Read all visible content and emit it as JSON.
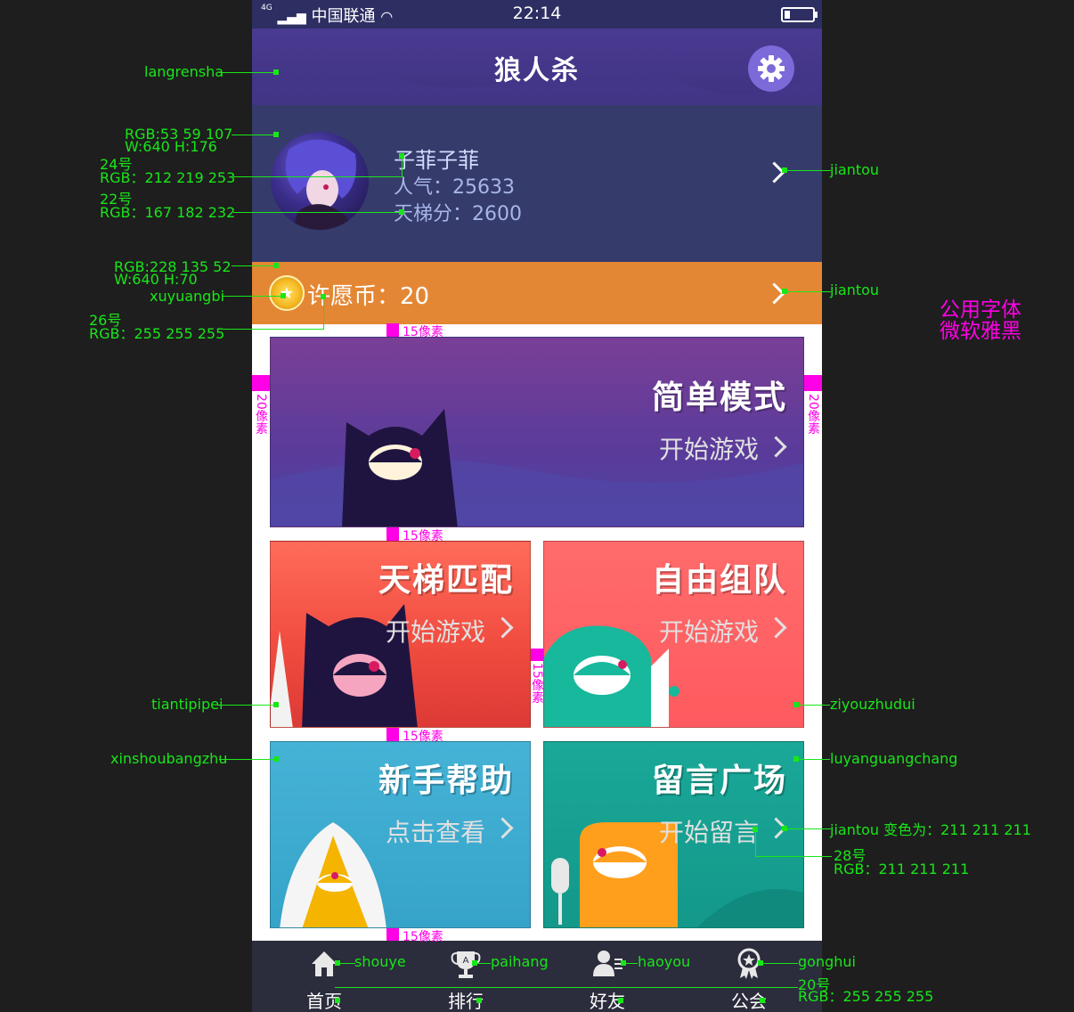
{
  "status_bar": {
    "network": "4G",
    "carrier": "中国联通",
    "time": "22:14"
  },
  "header": {
    "title": "狼人杀"
  },
  "profile": {
    "name": "子菲子菲",
    "popularity": "人气：25633",
    "ladder": "天梯分：2600"
  },
  "wish_coin": {
    "label": "许愿币：20"
  },
  "cards": [
    {
      "title": "简单模式",
      "action": "开始游戏"
    },
    {
      "title": "天梯匹配",
      "action": "开始游戏"
    },
    {
      "title": "自由组队",
      "action": "开始游戏"
    },
    {
      "title": "新手帮助",
      "action": "点击查看"
    },
    {
      "title": "留言广场",
      "action": "开始留言"
    }
  ],
  "tabs": [
    {
      "label": "首页",
      "icon": "home-icon"
    },
    {
      "label": "排行",
      "icon": "trophy-icon"
    },
    {
      "label": "好友",
      "icon": "friends-icon"
    },
    {
      "label": "公会",
      "icon": "guild-icon"
    }
  ],
  "annotations": {
    "langrensha": "langrensha",
    "profile_rgb": "RGB:53  59  107",
    "profile_size": "W:640   H:176",
    "name_size": "24号",
    "name_rgb": "RGB：212  219  253",
    "stat_size": "22号",
    "stat_rgb": "RGB：167  182  232",
    "coin_rgb": "RGB:228  135  52",
    "coin_size": "W:640   H:70",
    "xuyuangbi": "xuyuangbi",
    "coin_font_size": "26号",
    "coin_font_rgb": "RGB：255  255  255",
    "jiantou": "jiantou",
    "tiantipipei": "tiantipipei",
    "ziyouzhudui": "ziyouzhudui",
    "xinshoubangzhu": "xinshoubangzhu",
    "luyanguangchang": "luyanguangchang",
    "jiantou_color": "jiantou  变色为：211  211  211",
    "action_size": "28号",
    "action_rgb": "RGB：211  211  211",
    "shouye": "shouye",
    "paihang": "paihang",
    "haoyou": "haoyou",
    "gonghui": "gonghui",
    "tab_size": "20号",
    "tab_rgb": "RGB：255  255  255",
    "gap15": "15像素",
    "gap20": "20像素",
    "font_note_1": "公用字体",
    "font_note_2": "微软雅黑"
  },
  "colors": {
    "profile_bg": "#353b6b",
    "coin_bg": "#e48734",
    "name_text": "#d4dbfd",
    "stat_text": "#a7b6e8",
    "action_text": "#d3d3d3",
    "annotation": "#19e619",
    "spacing_marker": "#ff00e6"
  }
}
